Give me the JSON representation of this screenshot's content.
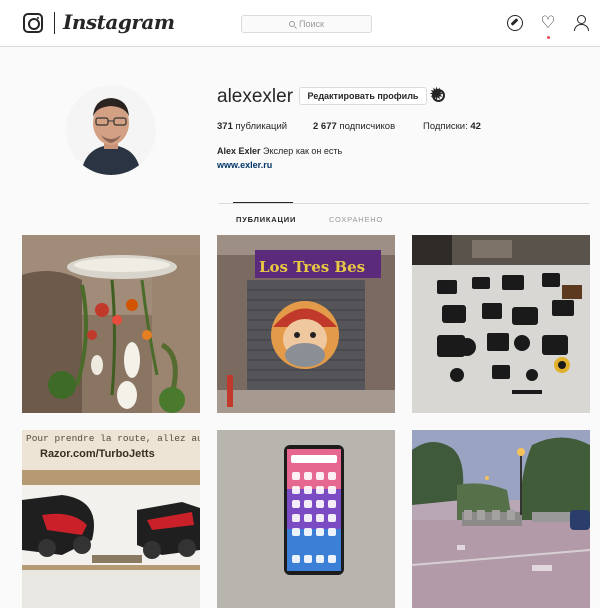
{
  "header": {
    "logo_text": "Instagram",
    "search_placeholder": "Поиск"
  },
  "profile": {
    "username": "alexexler",
    "edit_button": "Редактировать профиль",
    "stats": {
      "posts_count": "371",
      "posts_label": "публикаций",
      "followers_count": "2 677",
      "followers_label": "подписчиков",
      "following_label": "Подписки:",
      "following_count": "42"
    },
    "full_name": "Alex Exler",
    "bio": "Экслер как он есть",
    "website": "www.exler.ru"
  },
  "tabs": [
    {
      "label": "ПУБЛИКАЦИИ",
      "active": true
    },
    {
      "label": "СОХРАНЕНО",
      "active": false
    }
  ],
  "posts": [
    {
      "id": "flowers",
      "storefront_sign": ""
    },
    {
      "id": "shutter",
      "storefront_sign": "Los Tres Bes"
    },
    {
      "id": "cameras"
    },
    {
      "id": "box",
      "text_line1": "Pour prendre la route, allez au",
      "text_line2": "Razor.com/TurboJetts"
    },
    {
      "id": "phone"
    },
    {
      "id": "park"
    }
  ],
  "colors": {
    "link": "#003569",
    "notification_dot": "#ed4956",
    "border": "#dbdbdb"
  }
}
